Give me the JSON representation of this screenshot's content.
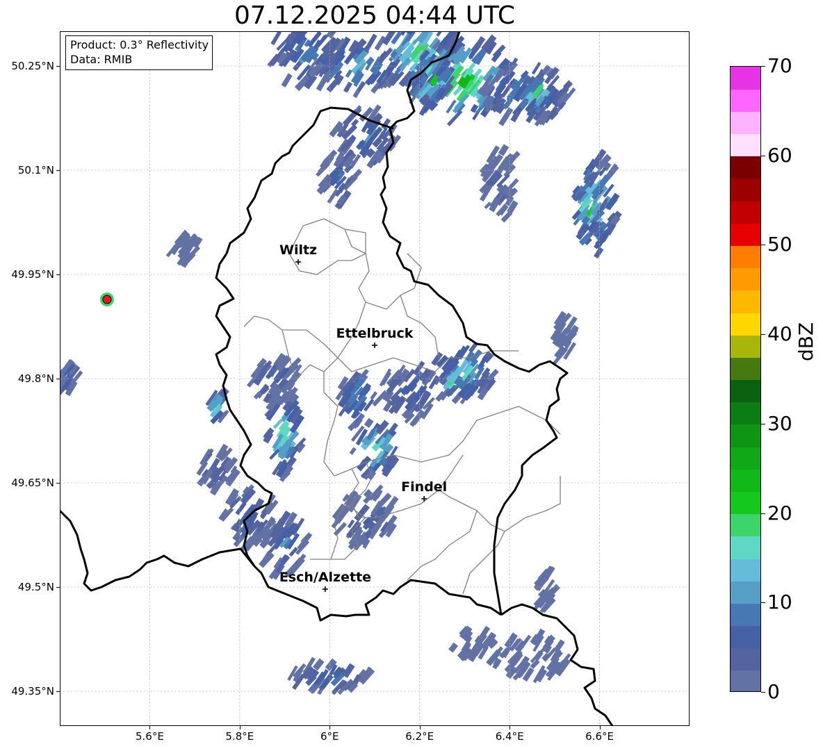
{
  "title": "07.12.2025 04:44 UTC",
  "info": {
    "product": "Product: 0.3° Reflectivity",
    "source": "Data: RMIB"
  },
  "axes": {
    "y_ticks": [
      "50.25°N",
      "50.1°N",
      "49.95°N",
      "49.8°N",
      "49.65°N",
      "49.5°N",
      "49.35°N"
    ],
    "x_ticks": [
      "5.6°E",
      "5.8°E",
      "6°E",
      "6.2°E",
      "6.4°E",
      "6.6°E"
    ],
    "lon_range": [
      5.4,
      6.8
    ],
    "lat_range": [
      49.3,
      50.3
    ]
  },
  "cities": [
    {
      "name": "Wiltz",
      "lon": 5.93,
      "lat": 49.968
    },
    {
      "name": "Ettelbruck",
      "lon": 6.1,
      "lat": 49.848
    },
    {
      "name": "Findel",
      "lon": 6.21,
      "lat": 49.627
    },
    {
      "name": "Esch/Alzette",
      "lon": 5.99,
      "lat": 49.497
    }
  ],
  "radar_site": {
    "lon": 5.505,
    "lat": 49.914,
    "color": "#e31a1c"
  },
  "colorbar": {
    "label": "dBZ",
    "min": 0,
    "max": 70,
    "tick_labels": [
      "0",
      "10",
      "20",
      "30",
      "40",
      "50",
      "60",
      "70"
    ],
    "colors": [
      "#6272a4",
      "#5464a0",
      "#4660a5",
      "#4878b4",
      "#579ec7",
      "#63bcd9",
      "#5ed8c4",
      "#3dd46c",
      "#14c81e",
      "#11b81a",
      "#10a816",
      "#0f9514",
      "#0c7d12",
      "#0a6110",
      "#467a10",
      "#a8b50a",
      "#ffd700",
      "#ffb800",
      "#ff9a00",
      "#ff7e00",
      "#e60000",
      "#c00000",
      "#9c0000",
      "#7a0000",
      "#ffe0ff",
      "#ffb3ff",
      "#ff66ff",
      "#e633e6"
    ]
  },
  "reflectivity_cells": [
    {
      "lon": 5.95,
      "lat": 50.27,
      "rx": 0.08,
      "ry": 0.05,
      "dbz": 12
    },
    {
      "lon": 6.06,
      "lat": 50.25,
      "rx": 0.1,
      "ry": 0.04,
      "dbz": 15
    },
    {
      "lon": 6.2,
      "lat": 50.27,
      "rx": 0.09,
      "ry": 0.05,
      "dbz": 22
    },
    {
      "lon": 6.3,
      "lat": 50.23,
      "rx": 0.12,
      "ry": 0.06,
      "dbz": 24
    },
    {
      "lon": 6.22,
      "lat": 50.23,
      "rx": 0.05,
      "ry": 0.03,
      "dbz": 27
    },
    {
      "lon": 6.44,
      "lat": 50.21,
      "rx": 0.1,
      "ry": 0.04,
      "dbz": 16
    },
    {
      "lon": 6.46,
      "lat": 50.21,
      "rx": 0.04,
      "ry": 0.02,
      "dbz": 23
    },
    {
      "lon": 6.08,
      "lat": 50.15,
      "rx": 0.07,
      "ry": 0.04,
      "dbz": 12
    },
    {
      "lon": 6.02,
      "lat": 50.09,
      "rx": 0.04,
      "ry": 0.04,
      "dbz": 10
    },
    {
      "lon": 6.59,
      "lat": 50.05,
      "rx": 0.05,
      "ry": 0.07,
      "dbz": 22
    },
    {
      "lon": 6.58,
      "lat": 50.05,
      "rx": 0.03,
      "ry": 0.04,
      "dbz": 25
    },
    {
      "lon": 6.38,
      "lat": 50.08,
      "rx": 0.04,
      "ry": 0.05,
      "dbz": 6
    },
    {
      "lon": 6.3,
      "lat": 49.81,
      "rx": 0.07,
      "ry": 0.04,
      "dbz": 18
    },
    {
      "lon": 6.27,
      "lat": 49.8,
      "rx": 0.02,
      "ry": 0.02,
      "dbz": 26
    },
    {
      "lon": 6.18,
      "lat": 49.78,
      "rx": 0.07,
      "ry": 0.04,
      "dbz": 10
    },
    {
      "lon": 6.1,
      "lat": 49.7,
      "rx": 0.05,
      "ry": 0.04,
      "dbz": 20
    },
    {
      "lon": 6.06,
      "lat": 49.77,
      "rx": 0.04,
      "ry": 0.04,
      "dbz": 14
    },
    {
      "lon": 5.9,
      "lat": 49.72,
      "rx": 0.04,
      "ry": 0.06,
      "dbz": 21
    },
    {
      "lon": 5.88,
      "lat": 49.8,
      "rx": 0.05,
      "ry": 0.04,
      "dbz": 8
    },
    {
      "lon": 5.75,
      "lat": 49.76,
      "rx": 0.02,
      "ry": 0.02,
      "dbz": 19
    },
    {
      "lon": 5.75,
      "lat": 49.67,
      "rx": 0.04,
      "ry": 0.03,
      "dbz": 8
    },
    {
      "lon": 5.82,
      "lat": 49.6,
      "rx": 0.06,
      "ry": 0.04,
      "dbz": 10
    },
    {
      "lon": 5.9,
      "lat": 49.56,
      "rx": 0.05,
      "ry": 0.04,
      "dbz": 13
    },
    {
      "lon": 6.08,
      "lat": 49.6,
      "rx": 0.07,
      "ry": 0.04,
      "dbz": 8
    },
    {
      "lon": 6.0,
      "lat": 49.37,
      "rx": 0.09,
      "ry": 0.02,
      "dbz": 10
    },
    {
      "lon": 6.45,
      "lat": 49.4,
      "rx": 0.1,
      "ry": 0.03,
      "dbz": 3
    },
    {
      "lon": 6.32,
      "lat": 49.42,
      "rx": 0.05,
      "ry": 0.02,
      "dbz": 3
    },
    {
      "lon": 6.52,
      "lat": 49.86,
      "rx": 0.02,
      "ry": 0.03,
      "dbz": 3
    },
    {
      "lon": 5.42,
      "lat": 49.8,
      "rx": 0.02,
      "ry": 0.02,
      "dbz": 12
    },
    {
      "lon": 5.68,
      "lat": 49.99,
      "rx": 0.03,
      "ry": 0.02,
      "dbz": 3
    },
    {
      "lon": 6.48,
      "lat": 49.5,
      "rx": 0.02,
      "ry": 0.03,
      "dbz": 3
    }
  ]
}
